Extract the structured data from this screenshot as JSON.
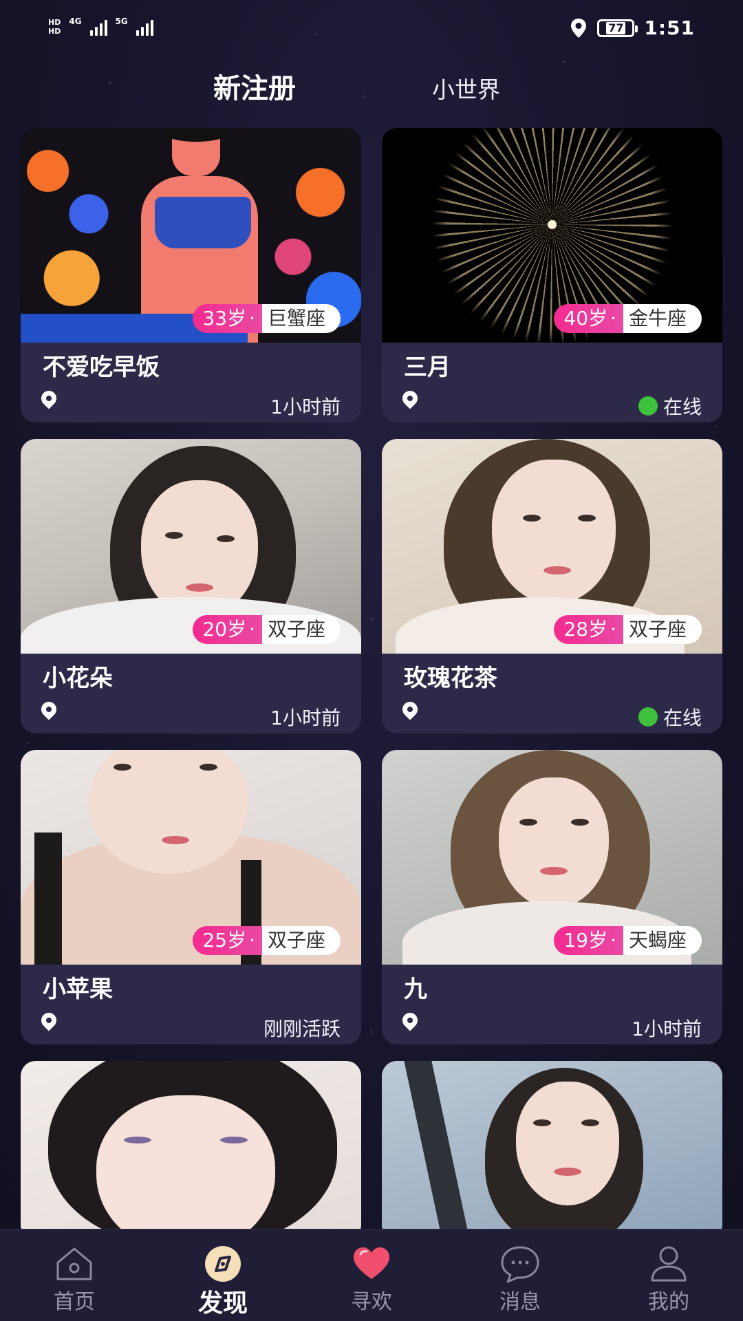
{
  "status_bar": {
    "sim1": "HD",
    "sim2": "HD",
    "network1": "4G",
    "network2": "5G",
    "battery": "77",
    "time": "1:51"
  },
  "tabs": [
    {
      "label": "新注册",
      "active": true
    },
    {
      "label": "小世界",
      "active": false
    }
  ],
  "cards": [
    {
      "name": "不爱吃早饭",
      "age": "33岁",
      "sign": "巨蟹座",
      "activity": "1小时前",
      "online": false,
      "photo": "illustration"
    },
    {
      "name": "三月",
      "age": "40岁",
      "sign": "金牛座",
      "activity": "在线",
      "online": true,
      "photo": "fireworks"
    },
    {
      "name": "小花朵",
      "age": "20岁",
      "sign": "双子座",
      "activity": "1小时前",
      "online": false,
      "photo": "portrait"
    },
    {
      "name": "玫瑰花茶",
      "age": "28岁",
      "sign": "双子座",
      "activity": "在线",
      "online": true,
      "photo": "portrait"
    },
    {
      "name": "小苹果",
      "age": "25岁",
      "sign": "双子座",
      "activity": "刚刚活跃",
      "online": false,
      "photo": "portrait"
    },
    {
      "name": "九",
      "age": "19岁",
      "sign": "天蝎座",
      "activity": "1小时前",
      "online": false,
      "photo": "portrait"
    }
  ],
  "bottom_nav": [
    {
      "label": "首页",
      "icon": "home-icon",
      "active": false
    },
    {
      "label": "发现",
      "icon": "compass-icon",
      "active": true
    },
    {
      "label": "寻欢",
      "icon": "heart-icon",
      "active": false
    },
    {
      "label": "消息",
      "icon": "chat-bubble-icon",
      "active": false
    },
    {
      "label": "我的",
      "icon": "user-icon",
      "active": false
    }
  ],
  "colors": {
    "background": "#17152c",
    "card_info": "#2c2a48",
    "age_pink": "#f42a8f",
    "online_green": "#3ec13c",
    "nav_bg": "#201e36",
    "heart_red": "#f0506e"
  }
}
